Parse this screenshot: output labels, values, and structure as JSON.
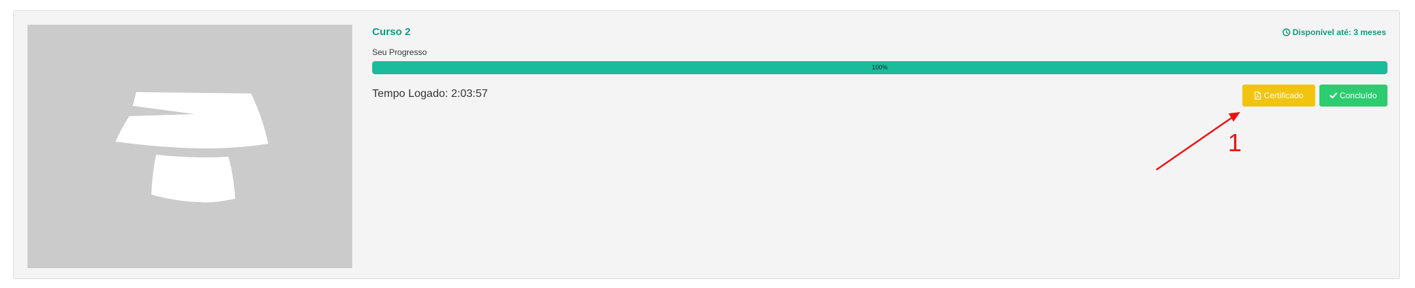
{
  "course": {
    "title": "Curso 2",
    "availability": "Disponível até: 3 meses",
    "progress_label": "Seu Progresso",
    "progress_value": 1.0,
    "progress_text": "100%",
    "time_logged": "Tempo Logado: 2:03:57",
    "thumbnail_icon": "placeholder-logo-icon"
  },
  "actions": {
    "certificate_label": "Certificado",
    "certificate_icon": "file-pdf-icon",
    "completed_label": "Concluído",
    "completed_icon": "check-icon"
  },
  "annotation": {
    "label": "1",
    "color": "#ee1111"
  },
  "colors": {
    "accent": "#17987e",
    "progress": "#1abc9c",
    "certificate": "#f1c40f",
    "completed": "#2ecc71"
  }
}
